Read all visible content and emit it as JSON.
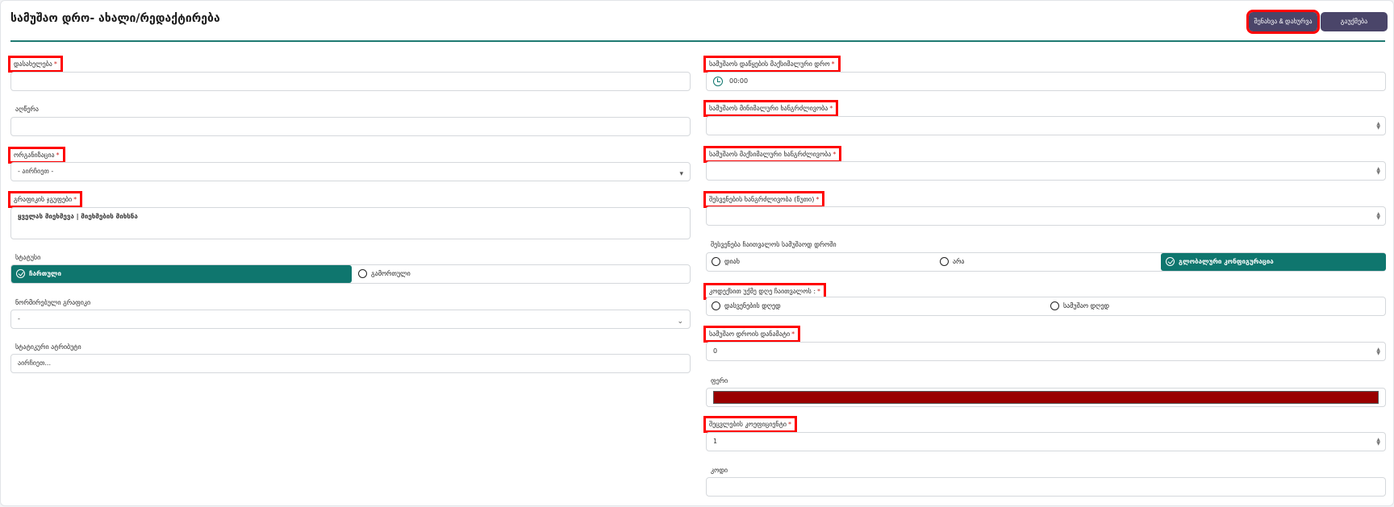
{
  "header": {
    "title": "სამუშაო დრო- ახალი/რედაქტირება",
    "save_label": "შენახვა & დახურვა",
    "cancel_label": "გაუქმება"
  },
  "left": {
    "name": {
      "label": "დასახელება",
      "required": "*",
      "value": ""
    },
    "description": {
      "label": "აღწერა",
      "value": ""
    },
    "organization": {
      "label": "ორგანიზაცია",
      "required": "*",
      "selected": "- აირჩიეთ -"
    },
    "schedule_groups": {
      "label": "გრაფიკის ჯგუფები",
      "required": "*",
      "value": "ყველას მიეხმევა | მიეხმების მიხსნა"
    },
    "status": {
      "label": "სტატუსი",
      "options": [
        "ჩართული",
        "გამორთული"
      ],
      "selected": "ჩართული"
    },
    "default_schedule": {
      "label": "ნორმირებული გრაფიკი",
      "selected": "-"
    },
    "static_attribute": {
      "label": "სტატიკური ატრიბუტი",
      "placeholder": "აირჩიეთ..."
    }
  },
  "right": {
    "min_start_time": {
      "label": "სამუშაოს დაწყების მაქსიმალური დრო",
      "required": "*",
      "value": "00:00"
    },
    "min_duration": {
      "label": "სამუშაოს მინიმალური ხანგრძლივობა",
      "required": "*",
      "value": ""
    },
    "max_duration": {
      "label": "სამუშაოს მაქსიმალური ხანგრძლივობა",
      "required": "*",
      "value": ""
    },
    "break_duration": {
      "label": "შესვენების ხანგრძლივობა (წუთი)",
      "required": "*",
      "value": ""
    },
    "break_in_work_time": {
      "label": "შესვენება ჩაითვალოს სამუშაოდ დროში",
      "options": [
        "დიახ",
        "არა",
        "გლობალური კონფიგურაცია"
      ],
      "selected": "გლობალური კონფიგურაცია"
    },
    "rounding_day": {
      "label": "კოდექსით უქმე დღე ჩაითვალოს :",
      "required": "*",
      "options": [
        "დასვენების დღედ",
        "სამუშაო დღედ"
      ]
    },
    "work_time_coefficient": {
      "label": "სამუშაო დროის დანამატი",
      "required": "*",
      "value": "0"
    },
    "color": {
      "label": "ფერი",
      "value": "#990000"
    },
    "shift_coefficient": {
      "label": "შეცვლების კოეფიციენტი",
      "required": "*",
      "value": "1"
    },
    "code": {
      "label": "კოდი",
      "value": ""
    }
  }
}
